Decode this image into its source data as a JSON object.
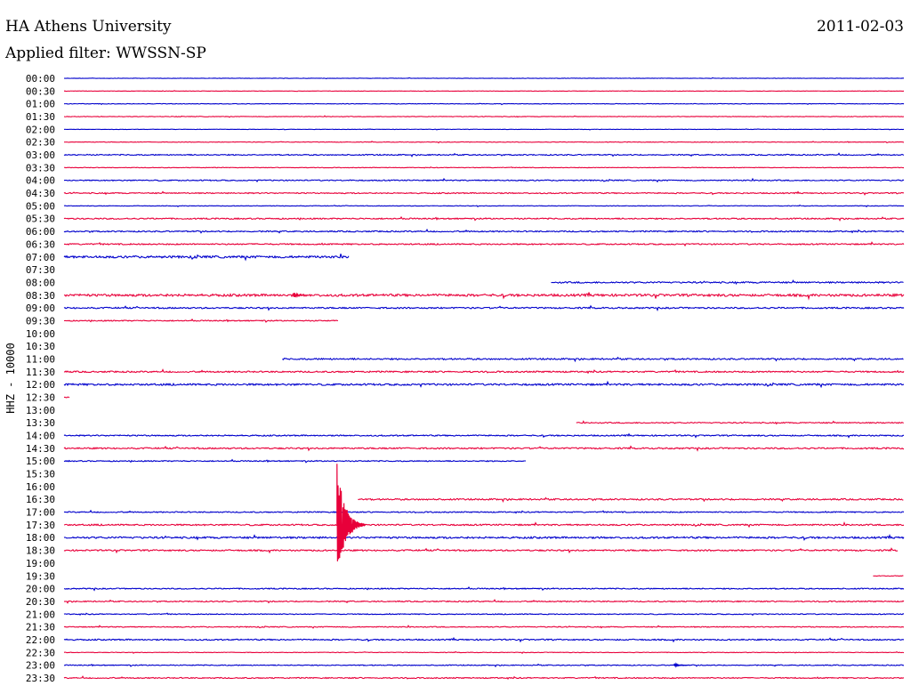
{
  "header": {
    "title": "HA Athens University",
    "subtitle": "Applied filter: WWSSN-SP",
    "date": "2011-02-03"
  },
  "colors": {
    "odd": "#0000cc",
    "even": "#e8003a"
  },
  "chart_data": {
    "type": "line",
    "title": "HA Athens University",
    "subtitle": "Applied filter: WWSSN-SP",
    "ylabel": "HHZ - 10000",
    "row_labels": [
      "00:00",
      "00:30",
      "01:00",
      "01:30",
      "02:00",
      "02:30",
      "03:00",
      "03:30",
      "04:00",
      "04:30",
      "05:00",
      "05:30",
      "06:00",
      "06:30",
      "07:00",
      "07:30",
      "08:00",
      "08:30",
      "09:00",
      "09:30",
      "10:00",
      "10:30",
      "11:00",
      "11:30",
      "12:00",
      "12:30",
      "13:00",
      "13:30",
      "14:00",
      "14:30",
      "15:00",
      "15:30",
      "16:00",
      "16:30",
      "17:00",
      "17:30",
      "18:00",
      "18:30",
      "19:00",
      "19:30",
      "20:00",
      "20:30",
      "21:00",
      "21:30",
      "22:00",
      "22:30",
      "23:00",
      "23:30"
    ],
    "row_minutes": 30,
    "traces": [
      {
        "row": 0,
        "start": 0,
        "end": 30,
        "noise": 0.2
      },
      {
        "row": 1,
        "start": 0,
        "end": 30,
        "noise": 0.2
      },
      {
        "row": 2,
        "start": 0,
        "end": 30,
        "noise": 0.3
      },
      {
        "row": 3,
        "start": 0,
        "end": 30,
        "noise": 0.3
      },
      {
        "row": 4,
        "start": 0,
        "end": 30,
        "noise": 0.2
      },
      {
        "row": 5,
        "start": 0,
        "end": 30,
        "noise": 0.3
      },
      {
        "row": 6,
        "start": 0,
        "end": 30,
        "noise": 0.6
      },
      {
        "row": 7,
        "start": 0,
        "end": 30,
        "noise": 0.3
      },
      {
        "row": 8,
        "start": 0,
        "end": 30,
        "noise": 0.6
      },
      {
        "row": 9,
        "start": 0,
        "end": 30,
        "noise": 0.6
      },
      {
        "row": 10,
        "start": 0,
        "end": 30,
        "noise": 0.3
      },
      {
        "row": 11,
        "start": 0,
        "end": 30,
        "noise": 0.7
      },
      {
        "row": 12,
        "start": 0,
        "end": 30,
        "noise": 0.7
      },
      {
        "row": 13,
        "start": 0,
        "end": 30,
        "noise": 0.7
      },
      {
        "row": 14,
        "start": 0,
        "end": 10.2,
        "noise": 1.2
      },
      {
        "row": 16,
        "start": 17.4,
        "end": 30,
        "noise": 0.8
      },
      {
        "row": 17,
        "start": 0,
        "end": 30,
        "noise": 1.3
      },
      {
        "row": 18,
        "start": 0,
        "end": 30,
        "noise": 0.8
      },
      {
        "row": 19,
        "start": 0,
        "end": 9.8,
        "noise": 0.6
      },
      {
        "row": 22,
        "start": 7.8,
        "end": 30,
        "noise": 0.8
      },
      {
        "row": 23,
        "start": 0,
        "end": 30,
        "noise": 0.8
      },
      {
        "row": 24,
        "start": 0,
        "end": 30,
        "noise": 1.0
      },
      {
        "row": 25,
        "start": 0,
        "end": 0.2,
        "noise": 0.5
      },
      {
        "row": 27,
        "start": 18.3,
        "end": 30,
        "noise": 0.6
      },
      {
        "row": 28,
        "start": 0,
        "end": 30,
        "noise": 0.7
      },
      {
        "row": 29,
        "start": 0,
        "end": 30,
        "noise": 0.8
      },
      {
        "row": 30,
        "start": 0,
        "end": 16.5,
        "noise": 0.6
      },
      {
        "row": 33,
        "start": 10.5,
        "end": 30,
        "noise": 0.8
      },
      {
        "row": 34,
        "start": 0,
        "end": 30,
        "noise": 0.6
      },
      {
        "row": 35,
        "start": 0,
        "end": 30,
        "noise": 0.8
      },
      {
        "row": 36,
        "start": 0,
        "end": 30,
        "noise": 1.0
      },
      {
        "row": 37,
        "start": 0,
        "end": 29.8,
        "noise": 0.8
      },
      {
        "row": 39,
        "start": 28.9,
        "end": 30,
        "noise": 0.3
      },
      {
        "row": 40,
        "start": 0,
        "end": 30,
        "noise": 0.6
      },
      {
        "row": 41,
        "start": 0,
        "end": 30,
        "noise": 0.6
      },
      {
        "row": 42,
        "start": 0,
        "end": 30,
        "noise": 0.5
      },
      {
        "row": 43,
        "start": 0,
        "end": 30,
        "noise": 0.5
      },
      {
        "row": 44,
        "start": 0,
        "end": 30,
        "noise": 0.7
      },
      {
        "row": 45,
        "start": 0,
        "end": 30,
        "noise": 0.3
      },
      {
        "row": 46,
        "start": 0,
        "end": 30,
        "noise": 0.5
      },
      {
        "row": 47,
        "start": 0,
        "end": 30,
        "noise": 0.6
      }
    ],
    "events": [
      {
        "row": 35,
        "minute": 9.75,
        "peak": 72,
        "decay_minutes": 1.0
      },
      {
        "row": 17,
        "minute": 8.2,
        "peak": 4,
        "decay_minutes": 0.4
      },
      {
        "row": 46,
        "minute": 21.8,
        "peak": 2,
        "decay_minutes": 0.5
      }
    ]
  }
}
